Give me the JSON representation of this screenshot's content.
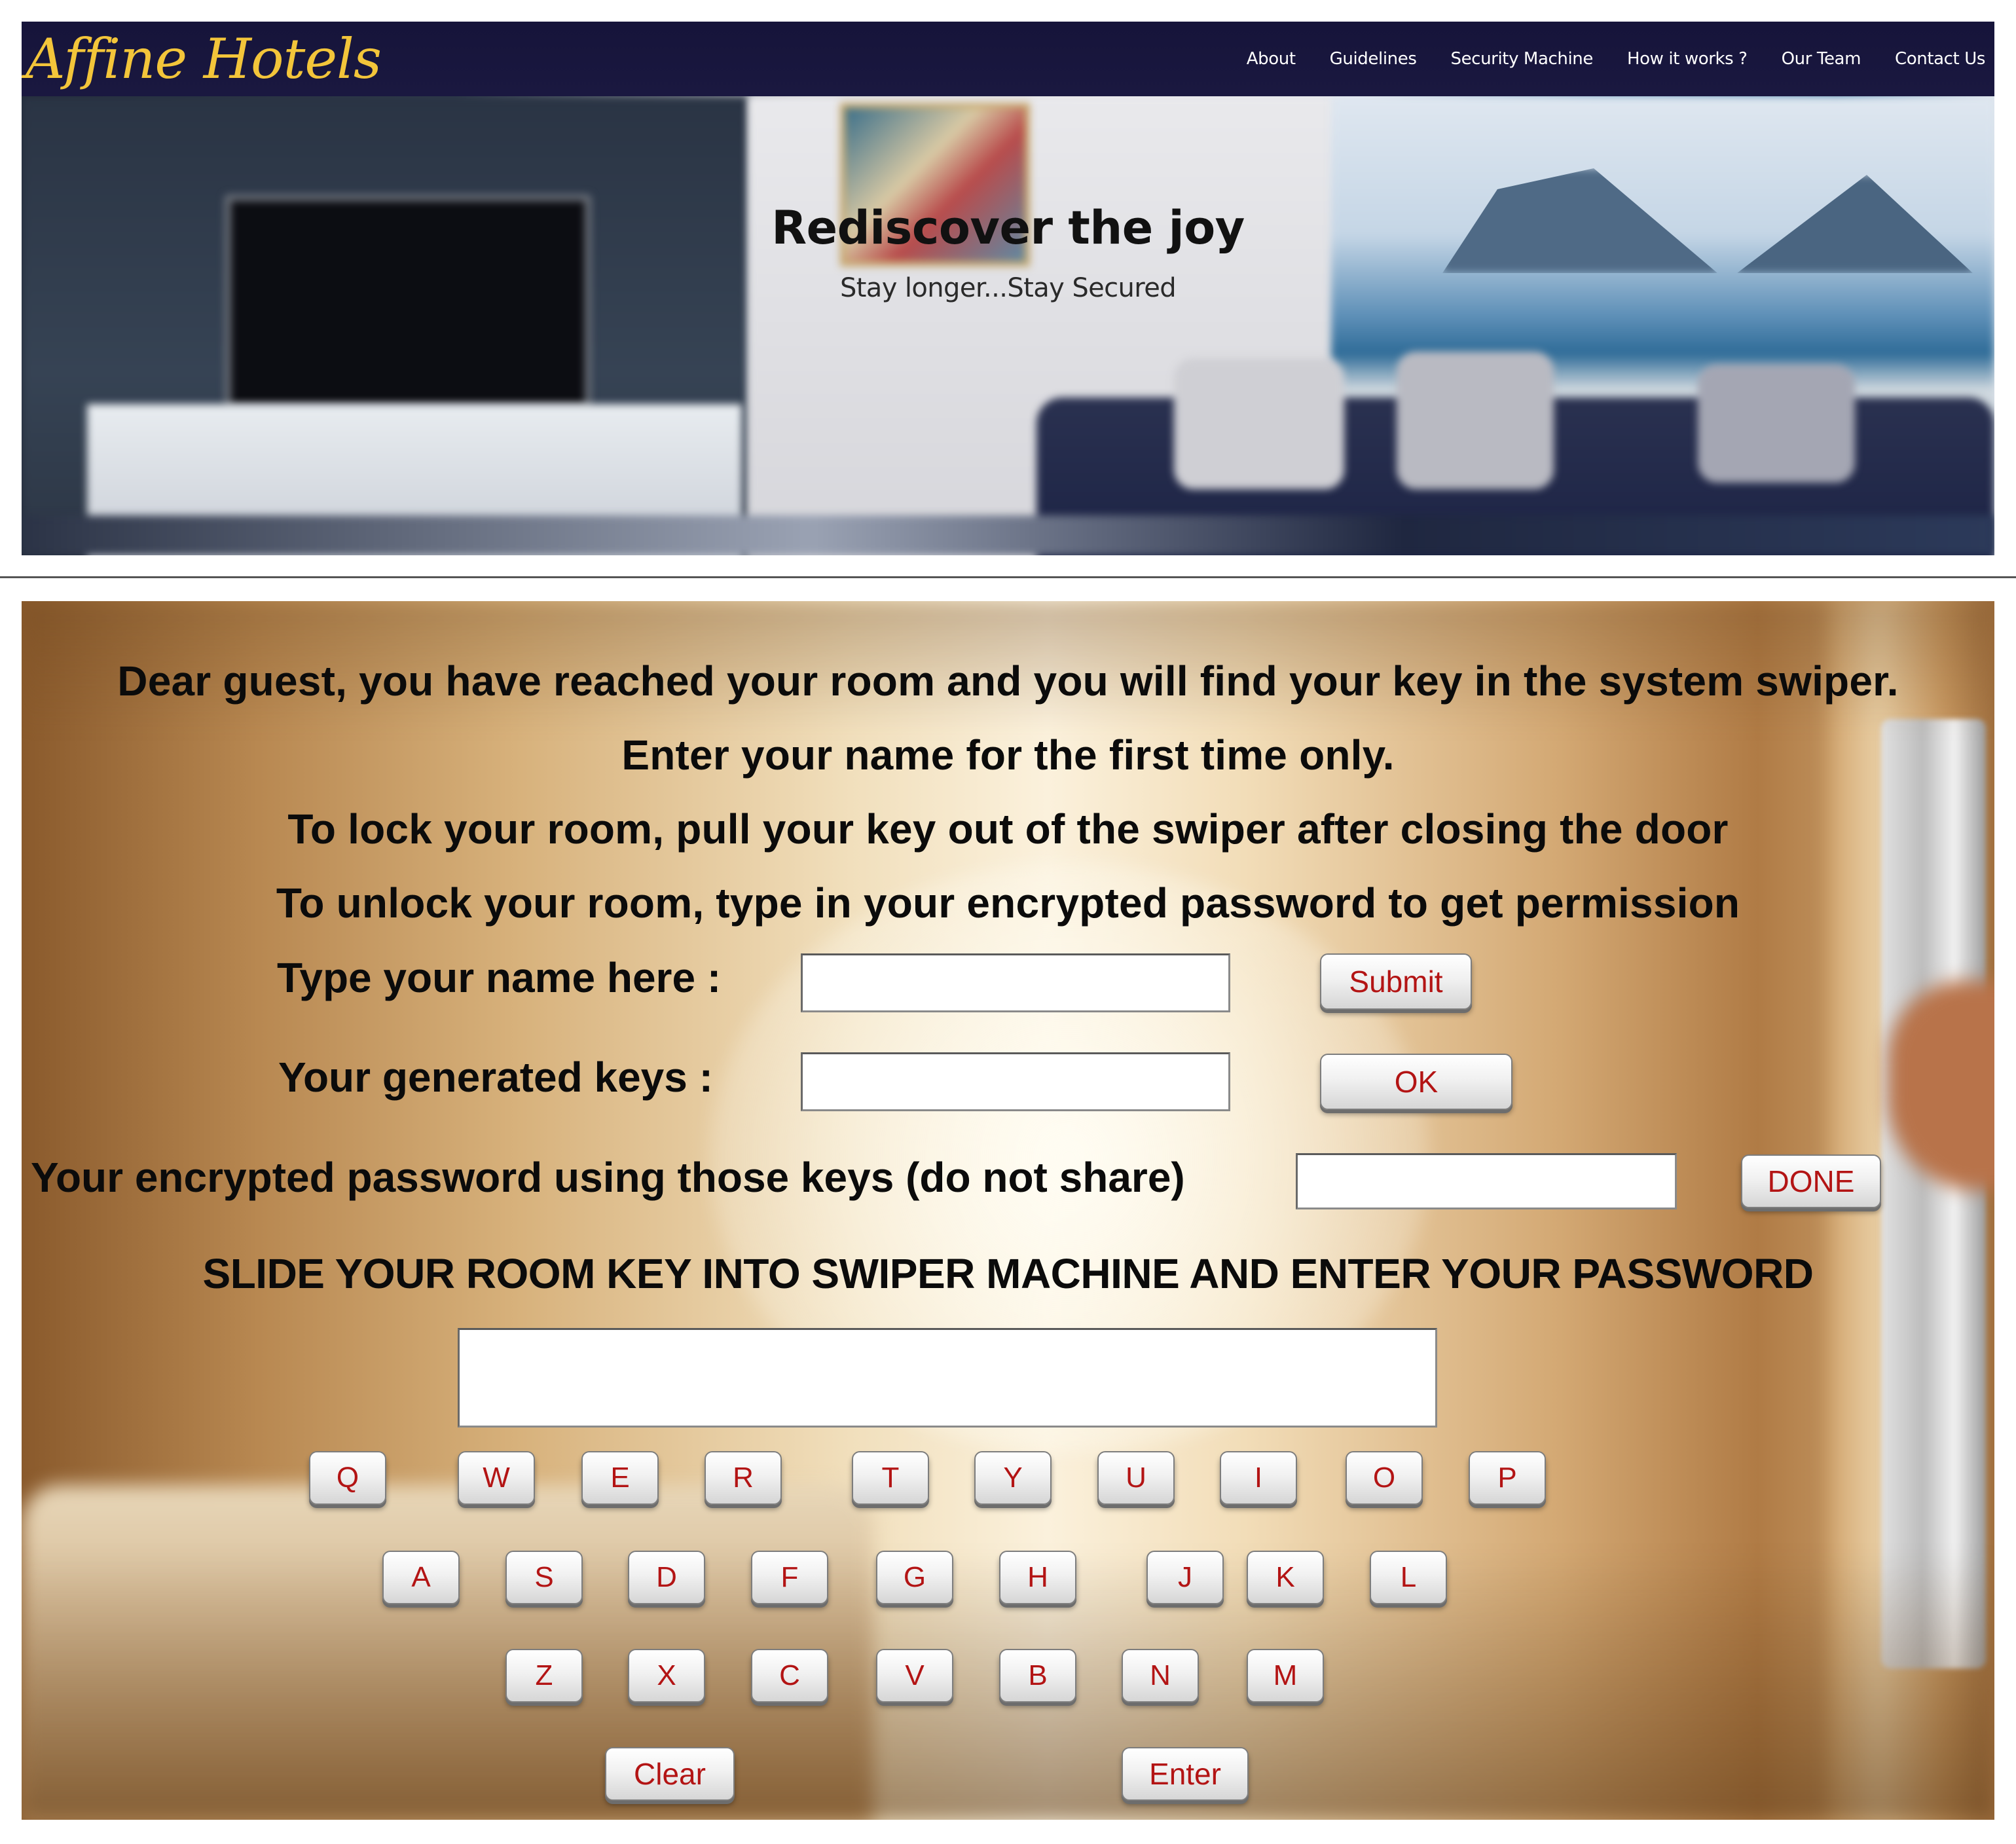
{
  "header": {
    "logo": "Affine Hotels",
    "nav": [
      "About",
      "Guidelines",
      "Security Machine",
      "How it works ?",
      "Our Team",
      "Contact Us"
    ]
  },
  "hero": {
    "title": "Rediscover the joy",
    "subtitle": "Stay longer...Stay Secured"
  },
  "machine": {
    "instructions": [
      "Dear guest, you have reached your room and you will find your key in the system swiper.",
      "Enter your name for the first time only.",
      "To lock your room,  pull your key out of the swiper after closing the door",
      "To unlock your room, type in your encrypted password to get permission"
    ],
    "name_label": "Type your name here :",
    "name_value": "",
    "submit_label": "Submit",
    "keys_label": "Your generated keys :",
    "keys_value": "",
    "ok_label": "OK",
    "password_label": "Your encrypted password using those keys (do not share)",
    "password_value": "",
    "done_label": "DONE",
    "slide_instruction": "SLIDE YOUR ROOM KEY INTO SWIPER MACHINE AND ENTER YOUR PASSWORD",
    "entry_value": "",
    "keyboard": {
      "row1": [
        "Q",
        "W",
        "E",
        "R",
        "T",
        "Y",
        "U",
        "I",
        "O",
        "P"
      ],
      "row2": [
        "A",
        "S",
        "D",
        "F",
        "G",
        "H",
        "J",
        "K",
        "L"
      ],
      "row3": [
        "Z",
        "X",
        "C",
        "V",
        "B",
        "N",
        "M"
      ]
    },
    "clear_label": "Clear",
    "enter_label": "Enter"
  },
  "colors": {
    "navbar": "#16143a",
    "logo": "#f3c53a",
    "button_text": "#b31414"
  }
}
